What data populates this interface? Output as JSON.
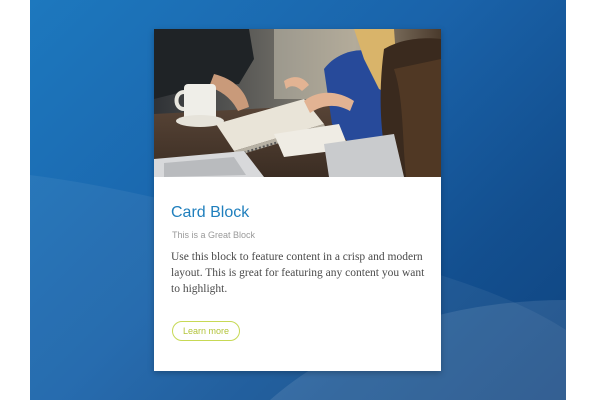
{
  "card": {
    "image_icon": "photo-people-working-at-table",
    "title": "Card Block",
    "subtitle": "This is a Great Block",
    "body": "Use this block to feature content in a crisp and modern layout. This is great for featuring any content you want to highlight.",
    "button_label": "Learn more"
  },
  "colors": {
    "background_start": "#1d78be",
    "background_end": "#0f447f",
    "title": "#1f7fbd",
    "button_accent": "#c7d955"
  }
}
